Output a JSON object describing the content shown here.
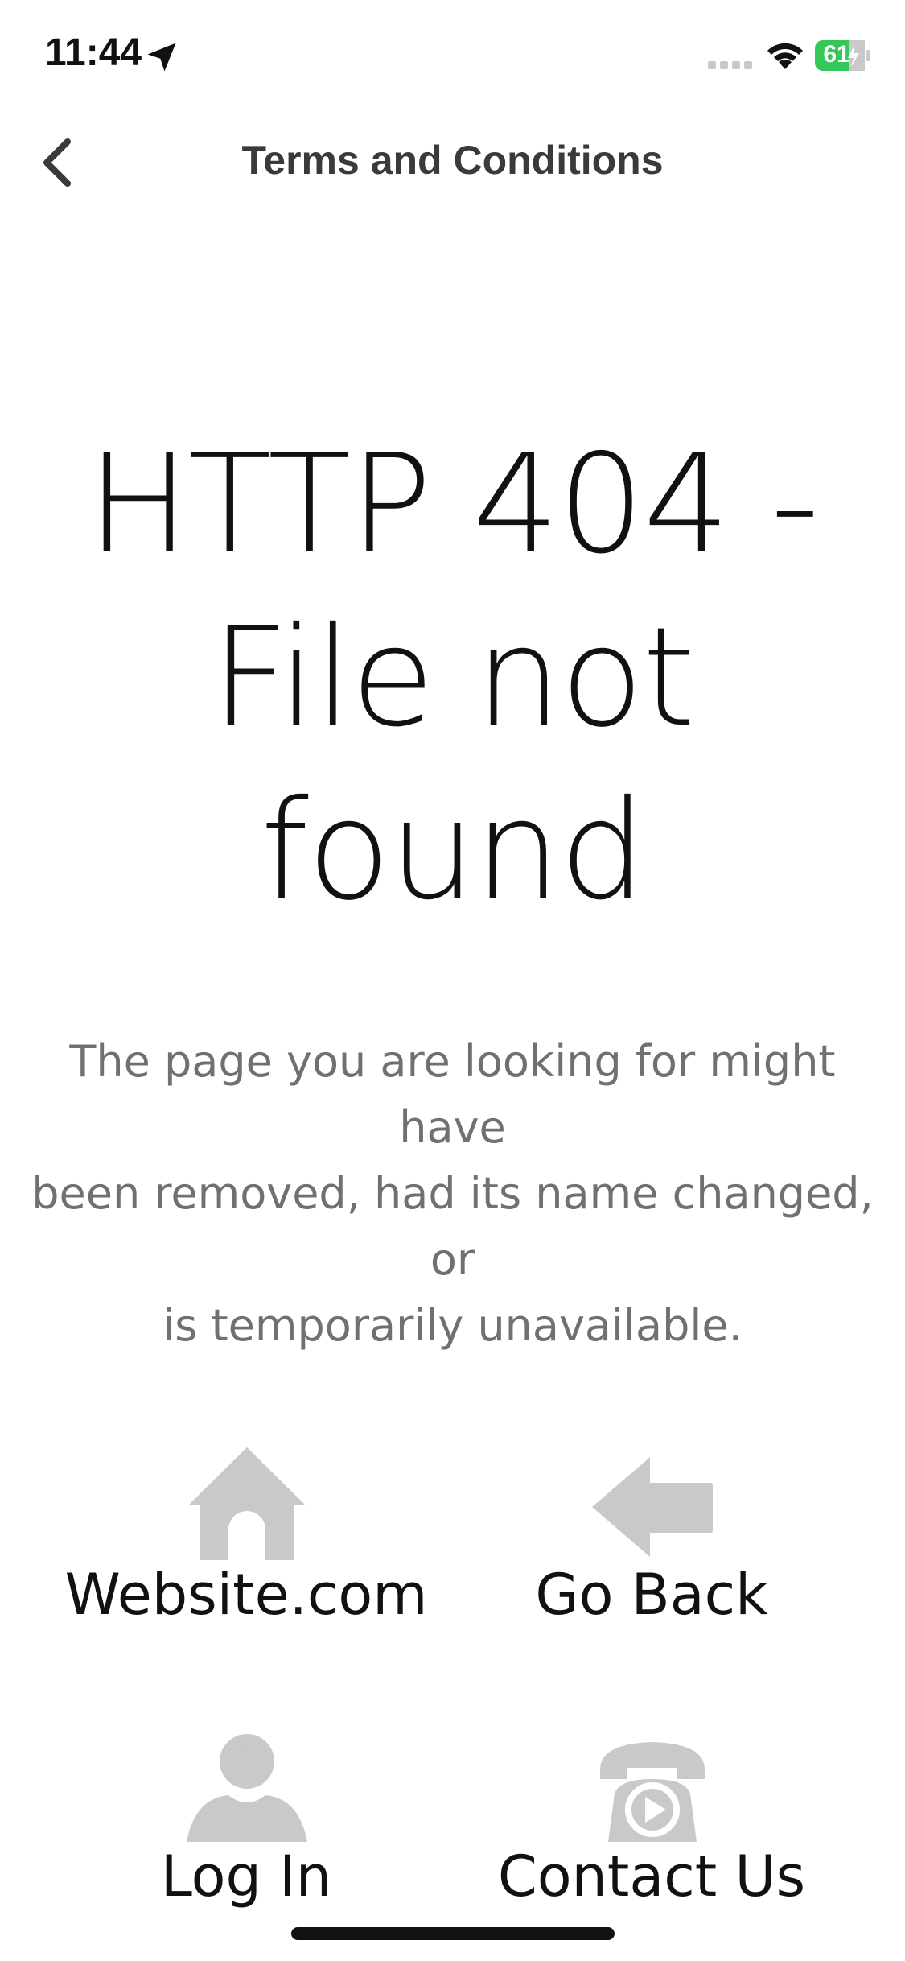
{
  "status_bar": {
    "time": "11:44",
    "battery_level": "61",
    "icons": [
      "location-arrow-icon",
      "signal-icon",
      "wifi-icon",
      "battery-charging-icon"
    ]
  },
  "nav": {
    "title": "Terms and Conditions",
    "back_icon": "chevron-left-icon"
  },
  "error": {
    "title_line1": "HTTP 404 -",
    "title_line2": "File not",
    "title_line3": "found",
    "description_line1": "The page you are looking for might have",
    "description_line2": "been removed, had its name changed, or",
    "description_line3": "is temporarily unavailable."
  },
  "actions": [
    {
      "label": "Website.com",
      "icon": "home-icon"
    },
    {
      "label": "Go Back",
      "icon": "arrow-left-icon"
    },
    {
      "label": "Log In",
      "icon": "user-icon"
    },
    {
      "label": "Contact Us",
      "icon": "phone-icon"
    }
  ],
  "colors": {
    "icon_gray": "#c8c9cb",
    "battery_green": "#34c759",
    "text_dark": "#111111",
    "text_muted": "#707070"
  }
}
